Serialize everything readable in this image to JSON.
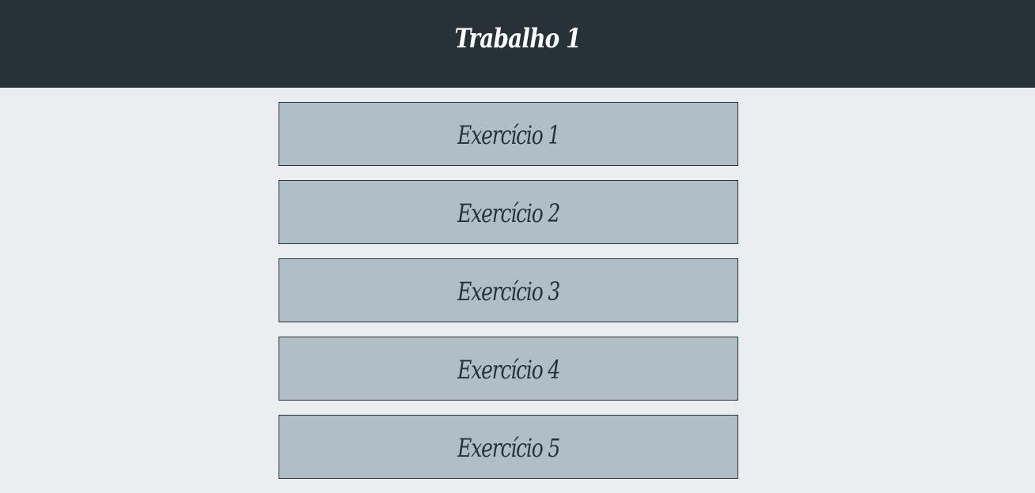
{
  "header": {
    "title": "Trabalho 1"
  },
  "exercises": [
    {
      "label": "Exercício 1"
    },
    {
      "label": "Exercício 2"
    },
    {
      "label": "Exercício 3"
    },
    {
      "label": "Exercício 4"
    },
    {
      "label": "Exercício 5"
    }
  ],
  "colors": {
    "header_bg": "#263238",
    "page_bg": "#ebeef1",
    "item_bg": "#b0bec5",
    "item_border": "#263238",
    "item_text": "#263238",
    "header_text": "#ffffff"
  }
}
